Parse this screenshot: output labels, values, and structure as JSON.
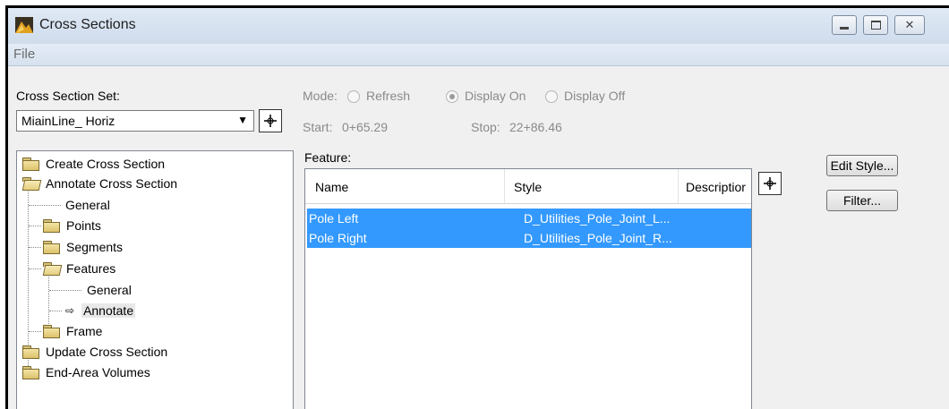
{
  "window": {
    "title": "Cross Sections",
    "controls": [
      "minimize",
      "maximize",
      "close"
    ]
  },
  "menu": {
    "file": "File"
  },
  "set": {
    "label": "Cross Section Set:",
    "value": "MiainLine_ Horiz"
  },
  "mode": {
    "label": "Mode:",
    "options": [
      "Refresh",
      "Display On",
      "Display Off"
    ],
    "selected": "Display On"
  },
  "range": {
    "start_label": "Start:",
    "start_value": "0+65.29",
    "stop_label": "Stop:",
    "stop_value": "22+86.46"
  },
  "tree": {
    "items": [
      {
        "label": "Create Cross Section",
        "icon": "folder-icon"
      },
      {
        "label": "Annotate Cross Section",
        "icon": "folder-open-icon"
      },
      {
        "label": "General",
        "icon": "none"
      },
      {
        "label": "Points",
        "icon": "folder-icon"
      },
      {
        "label": "Segments",
        "icon": "folder-icon"
      },
      {
        "label": "Features",
        "icon": "folder-open-icon"
      },
      {
        "label": "General",
        "icon": "none"
      },
      {
        "label": "Annotate",
        "icon": "arrow-right-icon",
        "selected": true
      },
      {
        "label": "Frame",
        "icon": "folder-icon"
      },
      {
        "label": "Update Cross Section",
        "icon": "folder-icon"
      },
      {
        "label": "End-Area Volumes",
        "icon": "folder-icon"
      }
    ]
  },
  "feature": {
    "label": "Feature:",
    "columns": [
      "Name",
      "Style",
      "Descriptior"
    ],
    "rows": [
      {
        "name": "Pole Left",
        "style": "D_Utilities_Pole_Joint_L..."
      },
      {
        "name": "Pole Right",
        "style": "D_Utilities_Pole_Joint_R..."
      }
    ]
  },
  "buttons": {
    "edit_style": "Edit Style...",
    "filter": "Filter..."
  },
  "colors": {
    "selection": "#3399ff",
    "titlebar": "#dfe9f5"
  }
}
